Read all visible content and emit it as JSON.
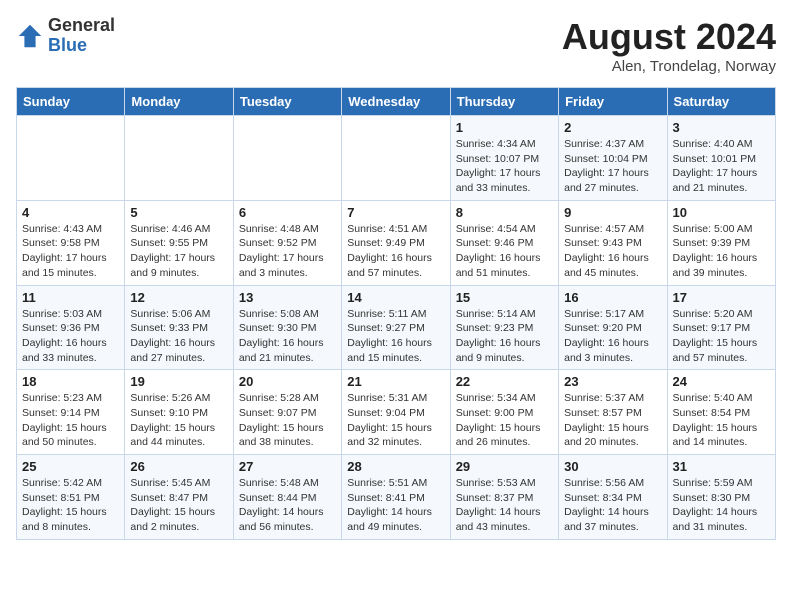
{
  "header": {
    "logo_general": "General",
    "logo_blue": "Blue",
    "title": "August 2024",
    "subtitle": "Alen, Trondelag, Norway"
  },
  "days_of_week": [
    "Sunday",
    "Monday",
    "Tuesday",
    "Wednesday",
    "Thursday",
    "Friday",
    "Saturday"
  ],
  "weeks": [
    [
      {
        "day": "",
        "content": ""
      },
      {
        "day": "",
        "content": ""
      },
      {
        "day": "",
        "content": ""
      },
      {
        "day": "",
        "content": ""
      },
      {
        "day": "1",
        "content": "Sunrise: 4:34 AM\nSunset: 10:07 PM\nDaylight: 17 hours\nand 33 minutes."
      },
      {
        "day": "2",
        "content": "Sunrise: 4:37 AM\nSunset: 10:04 PM\nDaylight: 17 hours\nand 27 minutes."
      },
      {
        "day": "3",
        "content": "Sunrise: 4:40 AM\nSunset: 10:01 PM\nDaylight: 17 hours\nand 21 minutes."
      }
    ],
    [
      {
        "day": "4",
        "content": "Sunrise: 4:43 AM\nSunset: 9:58 PM\nDaylight: 17 hours\nand 15 minutes."
      },
      {
        "day": "5",
        "content": "Sunrise: 4:46 AM\nSunset: 9:55 PM\nDaylight: 17 hours\nand 9 minutes."
      },
      {
        "day": "6",
        "content": "Sunrise: 4:48 AM\nSunset: 9:52 PM\nDaylight: 17 hours\nand 3 minutes."
      },
      {
        "day": "7",
        "content": "Sunrise: 4:51 AM\nSunset: 9:49 PM\nDaylight: 16 hours\nand 57 minutes."
      },
      {
        "day": "8",
        "content": "Sunrise: 4:54 AM\nSunset: 9:46 PM\nDaylight: 16 hours\nand 51 minutes."
      },
      {
        "day": "9",
        "content": "Sunrise: 4:57 AM\nSunset: 9:43 PM\nDaylight: 16 hours\nand 45 minutes."
      },
      {
        "day": "10",
        "content": "Sunrise: 5:00 AM\nSunset: 9:39 PM\nDaylight: 16 hours\nand 39 minutes."
      }
    ],
    [
      {
        "day": "11",
        "content": "Sunrise: 5:03 AM\nSunset: 9:36 PM\nDaylight: 16 hours\nand 33 minutes."
      },
      {
        "day": "12",
        "content": "Sunrise: 5:06 AM\nSunset: 9:33 PM\nDaylight: 16 hours\nand 27 minutes."
      },
      {
        "day": "13",
        "content": "Sunrise: 5:08 AM\nSunset: 9:30 PM\nDaylight: 16 hours\nand 21 minutes."
      },
      {
        "day": "14",
        "content": "Sunrise: 5:11 AM\nSunset: 9:27 PM\nDaylight: 16 hours\nand 15 minutes."
      },
      {
        "day": "15",
        "content": "Sunrise: 5:14 AM\nSunset: 9:23 PM\nDaylight: 16 hours\nand 9 minutes."
      },
      {
        "day": "16",
        "content": "Sunrise: 5:17 AM\nSunset: 9:20 PM\nDaylight: 16 hours\nand 3 minutes."
      },
      {
        "day": "17",
        "content": "Sunrise: 5:20 AM\nSunset: 9:17 PM\nDaylight: 15 hours\nand 57 minutes."
      }
    ],
    [
      {
        "day": "18",
        "content": "Sunrise: 5:23 AM\nSunset: 9:14 PM\nDaylight: 15 hours\nand 50 minutes."
      },
      {
        "day": "19",
        "content": "Sunrise: 5:26 AM\nSunset: 9:10 PM\nDaylight: 15 hours\nand 44 minutes."
      },
      {
        "day": "20",
        "content": "Sunrise: 5:28 AM\nSunset: 9:07 PM\nDaylight: 15 hours\nand 38 minutes."
      },
      {
        "day": "21",
        "content": "Sunrise: 5:31 AM\nSunset: 9:04 PM\nDaylight: 15 hours\nand 32 minutes."
      },
      {
        "day": "22",
        "content": "Sunrise: 5:34 AM\nSunset: 9:00 PM\nDaylight: 15 hours\nand 26 minutes."
      },
      {
        "day": "23",
        "content": "Sunrise: 5:37 AM\nSunset: 8:57 PM\nDaylight: 15 hours\nand 20 minutes."
      },
      {
        "day": "24",
        "content": "Sunrise: 5:40 AM\nSunset: 8:54 PM\nDaylight: 15 hours\nand 14 minutes."
      }
    ],
    [
      {
        "day": "25",
        "content": "Sunrise: 5:42 AM\nSunset: 8:51 PM\nDaylight: 15 hours\nand 8 minutes."
      },
      {
        "day": "26",
        "content": "Sunrise: 5:45 AM\nSunset: 8:47 PM\nDaylight: 15 hours\nand 2 minutes."
      },
      {
        "day": "27",
        "content": "Sunrise: 5:48 AM\nSunset: 8:44 PM\nDaylight: 14 hours\nand 56 minutes."
      },
      {
        "day": "28",
        "content": "Sunrise: 5:51 AM\nSunset: 8:41 PM\nDaylight: 14 hours\nand 49 minutes."
      },
      {
        "day": "29",
        "content": "Sunrise: 5:53 AM\nSunset: 8:37 PM\nDaylight: 14 hours\nand 43 minutes."
      },
      {
        "day": "30",
        "content": "Sunrise: 5:56 AM\nSunset: 8:34 PM\nDaylight: 14 hours\nand 37 minutes."
      },
      {
        "day": "31",
        "content": "Sunrise: 5:59 AM\nSunset: 8:30 PM\nDaylight: 14 hours\nand 31 minutes."
      }
    ]
  ]
}
